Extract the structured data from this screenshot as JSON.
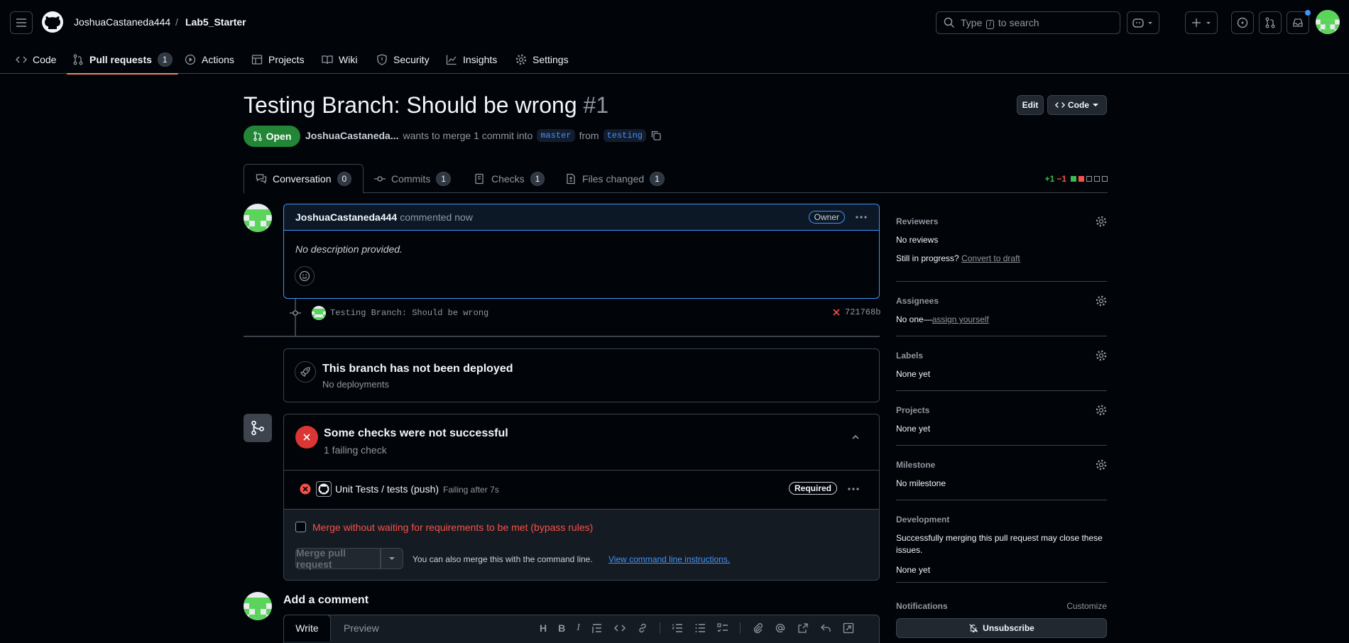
{
  "header": {
    "owner": "JoshuaCastaneda444",
    "separator": "/",
    "repo": "Lab5_Starter",
    "search_prefix": "Type",
    "search_key": "/",
    "search_suffix": "to search"
  },
  "repo_nav": {
    "items": [
      {
        "label": "Code",
        "icon": "code-icon"
      },
      {
        "label": "Pull requests",
        "icon": "pull-request-icon",
        "count": "1"
      },
      {
        "label": "Actions",
        "icon": "play-icon"
      },
      {
        "label": "Projects",
        "icon": "table-icon"
      },
      {
        "label": "Wiki",
        "icon": "book-icon"
      },
      {
        "label": "Security",
        "icon": "shield-icon"
      },
      {
        "label": "Insights",
        "icon": "graph-icon"
      },
      {
        "label": "Settings",
        "icon": "gear-icon"
      }
    ]
  },
  "pr": {
    "title": "Testing Branch: Should be wrong",
    "number": "#1",
    "edit_label": "Edit",
    "code_label": "Code",
    "state": "Open",
    "author": "JoshuaCastaneda...",
    "merge_text": "wants to merge 1 commit into",
    "base": "master",
    "from_text": "from",
    "head": "testing"
  },
  "tabs": [
    {
      "label": "Conversation",
      "count": "0"
    },
    {
      "label": "Commits",
      "count": "1"
    },
    {
      "label": "Checks",
      "count": "1"
    },
    {
      "label": "Files changed",
      "count": "1"
    }
  ],
  "diffstat": {
    "additions": "+1",
    "deletions": "−1"
  },
  "comment": {
    "author": "JoshuaCastaneda444",
    "action": "commented now",
    "badge": "Owner",
    "body": "No description provided."
  },
  "commit": {
    "message": "Testing Branch: Should be wrong",
    "sha": "721768b"
  },
  "deploy": {
    "title": "This branch has not been deployed",
    "subtitle": "No deployments"
  },
  "checks": {
    "title": "Some checks were not successful",
    "subtitle": "1 failing check",
    "check_name": "Unit Tests / tests (push)",
    "check_status": "Failing after 7s",
    "required": "Required",
    "bypass": "Merge without waiting for requirements to be met (bypass rules)",
    "merge_button": "Merge pull request",
    "cli_text": "You can also merge this with the command line.",
    "cli_link": "View command line instructions."
  },
  "add_comment": {
    "title": "Add a comment",
    "write_tab": "Write",
    "preview_tab": "Preview"
  },
  "sidebar": {
    "reviewers": {
      "title": "Reviewers",
      "value": "No reviews",
      "progress": "Still in progress?",
      "draft_link": "Convert to draft"
    },
    "assignees": {
      "title": "Assignees",
      "value": "No one—",
      "assign_link": "assign yourself"
    },
    "labels": {
      "title": "Labels",
      "value": "None yet"
    },
    "projects": {
      "title": "Projects",
      "value": "None yet"
    },
    "milestone": {
      "title": "Milestone",
      "value": "No milestone"
    },
    "development": {
      "title": "Development",
      "desc": "Successfully merging this pull request may close these issues.",
      "value": "None yet"
    },
    "notifications": {
      "title": "Notifications",
      "customize": "Customize",
      "unsubscribe": "Unsubscribe"
    }
  },
  "colors": {
    "accent": "#4493f8",
    "success": "#238636",
    "danger": "#da3633",
    "nav_underline": "#f78166"
  }
}
